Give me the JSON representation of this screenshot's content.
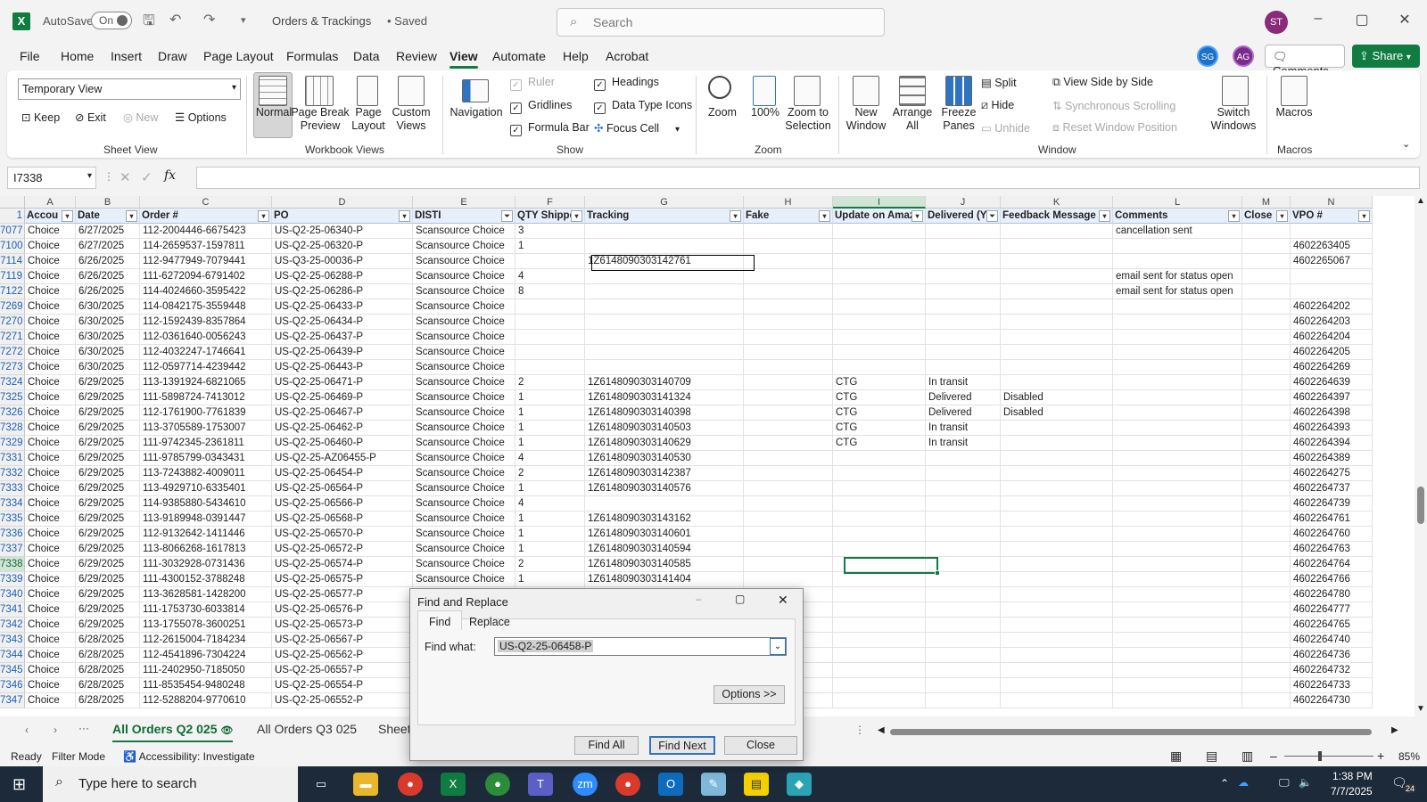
{
  "titlebar": {
    "autosave_label": "AutoSave",
    "autosave_state": "On",
    "doc_title": "Orders & Trackings",
    "saved": "• Saved",
    "search_placeholder": "Search",
    "user_initials": "ST"
  },
  "menu": {
    "items": [
      "File",
      "Home",
      "Insert",
      "Draw",
      "Page Layout",
      "Formulas",
      "Data",
      "Review",
      "View",
      "Automate",
      "Help",
      "Acrobat"
    ],
    "active": "View",
    "avatars": [
      "SG",
      "AG"
    ],
    "comments": "Comments",
    "share": "Share"
  },
  "ribbon": {
    "sheet_view": {
      "dropdown": "Temporary View",
      "keep": "Keep",
      "exit": "Exit",
      "new": "New",
      "options": "Options",
      "group": "Sheet View"
    },
    "workbook_views": {
      "normal": "Normal",
      "page_break": "Page Break Preview",
      "page_layout": "Page Layout",
      "custom": "Custom Views",
      "group": "Workbook Views"
    },
    "show": {
      "navigation": "Navigation",
      "ruler": "Ruler",
      "gridlines": "Gridlines",
      "formula_bar": "Formula Bar",
      "headings": "Headings",
      "data_type_icons": "Data Type Icons",
      "focus_cell": "Focus Cell",
      "group": "Show"
    },
    "zoom": {
      "zoom": "Zoom",
      "hundred": "100%",
      "zoom_sel": "Zoom to Selection",
      "group": "Zoom"
    },
    "window": {
      "new_window": "New Window",
      "arrange_all": "Arrange All",
      "freeze": "Freeze Panes",
      "split": "Split",
      "hide": "Hide",
      "unhide": "Unhide",
      "side_by_side": "View Side by Side",
      "sync_scroll": "Synchronous Scrolling",
      "reset_pos": "Reset Window Position",
      "switch": "Switch Windows",
      "group": "Window"
    },
    "macros": {
      "macros": "Macros",
      "group": "Macros"
    }
  },
  "formula": {
    "name_box": "I7338",
    "value": ""
  },
  "columns": [
    "A",
    "B",
    "C",
    "D",
    "E",
    "F",
    "G",
    "H",
    "I",
    "J",
    "K",
    "L",
    "M",
    "N"
  ],
  "headers": [
    "Accou",
    "Date",
    "Order #",
    "PO",
    "DISTI",
    "QTY Shipped",
    "Tracking",
    "Fake",
    "Update on Amaz",
    "Delivered (Y/",
    "Feedback Message",
    "Comments",
    "Close",
    "VPO #"
  ],
  "rows": [
    {
      "n": "1",
      "c": []
    },
    {
      "n": "7077",
      "c": [
        "Choice",
        "6/27/2025",
        "112-2004446-6675423",
        "US-Q2-25-06340-P",
        "Scansource Choice",
        "3",
        "",
        "",
        "",
        "",
        "",
        "cancellation sent",
        "",
        ""
      ]
    },
    {
      "n": "7100",
      "c": [
        "Choice",
        "6/27/2025",
        "114-2659537-1597811",
        "US-Q2-25-06320-P",
        "Scansource Choice",
        "1",
        "",
        "",
        "",
        "",
        "",
        "",
        "",
        "4602263405"
      ]
    },
    {
      "n": "7114",
      "c": [
        "Choice",
        "6/26/2025",
        "112-9477949-7079441",
        "US-Q3-25-00036-P",
        "Scansource Choice",
        "",
        "1Z6148090303142761",
        "",
        "",
        "",
        "",
        "",
        "",
        "4602265067"
      ]
    },
    {
      "n": "7119",
      "c": [
        "Choice",
        "6/26/2025",
        "111-6272094-6791402",
        "US-Q2-25-06288-P",
        "Scansource Choice",
        "4",
        "",
        "",
        "",
        "",
        "",
        "email sent for status open",
        "",
        ""
      ]
    },
    {
      "n": "7122",
      "c": [
        "Choice",
        "6/26/2025",
        "114-4024660-3595422",
        "US-Q2-25-06286-P",
        "Scansource Choice",
        "8",
        "",
        "",
        "",
        "",
        "",
        "email sent for status open",
        "",
        ""
      ]
    },
    {
      "n": "7269",
      "c": [
        "Choice",
        "6/30/2025",
        "114-0842175-3559448",
        "US-Q2-25-06433-P",
        "Scansource Choice",
        "",
        "",
        "",
        "",
        "",
        "",
        "",
        "",
        "4602264202"
      ]
    },
    {
      "n": "7270",
      "c": [
        "Choice",
        "6/30/2025",
        "112-1592439-8357864",
        "US-Q2-25-06434-P",
        "Scansource Choice",
        "",
        "",
        "",
        "",
        "",
        "",
        "",
        "",
        "4602264203"
      ]
    },
    {
      "n": "7271",
      "c": [
        "Choice",
        "6/30/2025",
        "112-0361640-0056243",
        "US-Q2-25-06437-P",
        "Scansource Choice",
        "",
        "",
        "",
        "",
        "",
        "",
        "",
        "",
        "4602264204"
      ]
    },
    {
      "n": "7272",
      "c": [
        "Choice",
        "6/30/2025",
        "112-4032247-1746641",
        "US-Q2-25-06439-P",
        "Scansource Choice",
        "",
        "",
        "",
        "",
        "",
        "",
        "",
        "",
        "4602264205"
      ]
    },
    {
      "n": "7273",
      "c": [
        "Choice",
        "6/30/2025",
        "112-0597714-4239442",
        "US-Q2-25-06443-P",
        "Scansource Choice",
        "",
        "",
        "",
        "",
        "",
        "",
        "",
        "",
        "4602264269"
      ]
    },
    {
      "n": "7324",
      "c": [
        "Choice",
        "6/29/2025",
        "113-1391924-6821065",
        "US-Q2-25-06471-P",
        "Scansource Choice",
        "2",
        "1Z6148090303140709",
        "",
        "CTG",
        "In transit",
        "",
        "",
        "",
        "4602264639"
      ]
    },
    {
      "n": "7325",
      "c": [
        "Choice",
        "6/29/2025",
        "111-5898724-7413012",
        "US-Q2-25-06469-P",
        "Scansource Choice",
        "1",
        "1Z6148090303141324",
        "",
        "CTG",
        "Delivered",
        "Disabled",
        "",
        "",
        "4602264397"
      ]
    },
    {
      "n": "7326",
      "c": [
        "Choice",
        "6/29/2025",
        "112-1761900-7761839",
        "US-Q2-25-06467-P",
        "Scansource Choice",
        "1",
        "1Z6148090303140398",
        "",
        "CTG",
        "Delivered",
        "Disabled",
        "",
        "",
        "4602264398"
      ]
    },
    {
      "n": "7328",
      "c": [
        "Choice",
        "6/29/2025",
        "113-3705589-1753007",
        "US-Q2-25-06462-P",
        "Scansource Choice",
        "1",
        "1Z6148090303140503",
        "",
        "CTG",
        "In transit",
        "",
        "",
        "",
        "4602264393"
      ]
    },
    {
      "n": "7329",
      "c": [
        "Choice",
        "6/29/2025",
        "111-9742345-2361811",
        "US-Q2-25-06460-P",
        "Scansource Choice",
        "1",
        "1Z6148090303140629",
        "",
        "CTG",
        "In transit",
        "",
        "",
        "",
        "4602264394"
      ]
    },
    {
      "n": "7331",
      "c": [
        "Choice",
        "6/29/2025",
        "111-9785799-0343431",
        "US-Q2-25-AZ06455-P",
        "Scansource Choice",
        "4",
        "1Z6148090303140530",
        "",
        "",
        "",
        "",
        "",
        "",
        "4602264389"
      ]
    },
    {
      "n": "7332",
      "c": [
        "Choice",
        "6/29/2025",
        "113-7243882-4009011",
        "US-Q2-25-06454-P",
        "Scansource Choice",
        "2",
        "1Z6148090303142387",
        "",
        "",
        "",
        "",
        "",
        "",
        "4602264275"
      ]
    },
    {
      "n": "7333",
      "c": [
        "Choice",
        "6/29/2025",
        "113-4929710-6335401",
        "US-Q2-25-06564-P",
        "Scansource Choice",
        "1",
        "1Z6148090303140576",
        "",
        "",
        "",
        "",
        "",
        "",
        "4602264737"
      ]
    },
    {
      "n": "7334",
      "c": [
        "Choice",
        "6/29/2025",
        "114-9385880-5434610",
        "US-Q2-25-06566-P",
        "Scansource Choice",
        "4",
        "",
        "",
        "",
        "",
        "",
        "",
        "",
        "4602264739"
      ]
    },
    {
      "n": "7335",
      "c": [
        "Choice",
        "6/29/2025",
        "113-9189948-0391447",
        "US-Q2-25-06568-P",
        "Scansource Choice",
        "1",
        "1Z6148090303143162",
        "",
        "",
        "",
        "",
        "",
        "",
        "4602264761"
      ]
    },
    {
      "n": "7336",
      "c": [
        "Choice",
        "6/29/2025",
        "112-9132642-1411446",
        "US-Q2-25-06570-P",
        "Scansource Choice",
        "1",
        "1Z6148090303140601",
        "",
        "",
        "",
        "",
        "",
        "",
        "4602264760"
      ]
    },
    {
      "n": "7337",
      "c": [
        "Choice",
        "6/29/2025",
        "113-8066268-1617813",
        "US-Q2-25-06572-P",
        "Scansource Choice",
        "1",
        "1Z6148090303140594",
        "",
        "",
        "",
        "",
        "",
        "",
        "4602264763"
      ]
    },
    {
      "n": "7338",
      "c": [
        "Choice",
        "6/29/2025",
        "111-3032928-0731436",
        "US-Q2-25-06574-P",
        "Scansource Choice",
        "2",
        "1Z6148090303140585",
        "",
        "",
        "",
        "",
        "",
        "",
        "4602264764"
      ]
    },
    {
      "n": "7339",
      "c": [
        "Choice",
        "6/29/2025",
        "111-4300152-3788248",
        "US-Q2-25-06575-P",
        "Scansource Choice",
        "1",
        "1Z6148090303141404",
        "",
        "",
        "",
        "",
        "",
        "",
        "4602264766"
      ]
    },
    {
      "n": "7340",
      "c": [
        "Choice",
        "6/29/2025",
        "113-3628581-1428200",
        "US-Q2-25-06577-P",
        "",
        "",
        "",
        "",
        "",
        "",
        "",
        "",
        "",
        "4602264780"
      ]
    },
    {
      "n": "7341",
      "c": [
        "Choice",
        "6/29/2025",
        "111-1753730-6033814",
        "US-Q2-25-06576-P",
        "",
        "",
        "",
        "",
        "",
        "",
        "",
        "",
        "",
        "4602264777"
      ]
    },
    {
      "n": "7342",
      "c": [
        "Choice",
        "6/29/2025",
        "113-1755078-3600251",
        "US-Q2-25-06573-P",
        "",
        "",
        "",
        "",
        "",
        "",
        "",
        "",
        "",
        "4602264765"
      ]
    },
    {
      "n": "7343",
      "c": [
        "Choice",
        "6/28/2025",
        "112-2615004-7184234",
        "US-Q2-25-06567-P",
        "",
        "",
        "",
        "",
        "",
        "",
        "",
        "",
        "",
        "4602264740"
      ]
    },
    {
      "n": "7344",
      "c": [
        "Choice",
        "6/28/2025",
        "112-4541896-7304224",
        "US-Q2-25-06562-P",
        "",
        "",
        "",
        "",
        "",
        "",
        "",
        "",
        "",
        "4602264736"
      ]
    },
    {
      "n": "7345",
      "c": [
        "Choice",
        "6/28/2025",
        "111-2402950-7185050",
        "US-Q2-25-06557-P",
        "",
        "",
        "",
        "",
        "",
        "",
        "",
        "",
        "",
        "4602264732"
      ]
    },
    {
      "n": "7346",
      "c": [
        "Choice",
        "6/28/2025",
        "111-8535454-9480248",
        "US-Q2-25-06554-P",
        "",
        "",
        "",
        "",
        "",
        "",
        "",
        "",
        "",
        "4602264733"
      ]
    },
    {
      "n": "7347",
      "c": [
        "Choice",
        "6/28/2025",
        "112-5288204-9770610",
        "US-Q2-25-06552-P",
        "",
        "",
        "",
        "",
        "",
        "",
        "",
        "",
        "",
        "4602264730"
      ]
    }
  ],
  "sheets": {
    "tabs": [
      "All Orders Q2 025",
      "All Orders Q3 025",
      "Sheet"
    ],
    "active": "All Orders Q2 025"
  },
  "status": {
    "ready": "Ready",
    "filter": "Filter Mode",
    "accessibility": "Accessibility: Investigate",
    "zoom": "85%"
  },
  "dialog": {
    "title": "Find and Replace",
    "tab_find": "Find",
    "tab_replace": "Replace",
    "find_label": "Find what:",
    "find_value": "US-Q2-25-06458-P",
    "options": "Options >>",
    "find_all": "Find All",
    "find_next": "Find Next",
    "close": "Close"
  },
  "taskbar": {
    "search": "Type here to search",
    "time": "1:38 PM",
    "date": "7/7/2025",
    "notif": "24"
  },
  "colors": {
    "accent": "#107c41",
    "header_fill": "#e7effb"
  }
}
